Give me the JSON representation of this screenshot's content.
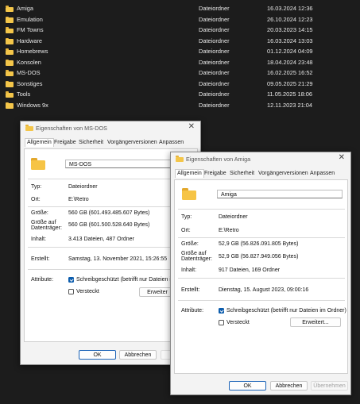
{
  "file_list": [
    {
      "name": "Amiga",
      "type": "Dateiordner",
      "date": "16.03.2024 12:36"
    },
    {
      "name": "Emulation",
      "type": "Dateiordner",
      "date": "26.10.2024 12:23"
    },
    {
      "name": "FM Towns",
      "type": "Dateiordner",
      "date": "20.03.2023 14:15"
    },
    {
      "name": "Hardware",
      "type": "Dateiordner",
      "date": "16.03.2024 13:03"
    },
    {
      "name": "Homebrews",
      "type": "Dateiordner",
      "date": "01.12.2024 04:09"
    },
    {
      "name": "Konsolen",
      "type": "Dateiordner",
      "date": "18.04.2024 23:48"
    },
    {
      "name": "MS-DOS",
      "type": "Dateiordner",
      "date": "16.02.2025 16:52"
    },
    {
      "name": "Sonstiges",
      "type": "Dateiordner",
      "date": "09.05.2025 21:29"
    },
    {
      "name": "Tools",
      "type": "Dateiordner",
      "date": "11.05.2025 18:06"
    },
    {
      "name": "Windows 9x",
      "type": "Dateiordner",
      "date": "12.11.2023 21:04"
    }
  ],
  "dlg1": {
    "title": "Eigenschaften von MS-DOS",
    "tabs": [
      "Allgemein",
      "Freigabe",
      "Sicherheit",
      "Vorgängerversionen",
      "Anpassen"
    ],
    "folder_name": "MS-DOS",
    "typ_label": "Typ:",
    "typ": "Dateiordner",
    "ort_label": "Ort:",
    "ort": "E:\\Retro",
    "groesse_label": "Größe:",
    "groesse": "560 GB (601.493.485.607 Bytes)",
    "groesse_dt_label1": "Größe auf",
    "groesse_dt_label2": "Datenträger:",
    "groesse_dt": "560 GB (601.500.528.640 Bytes)",
    "inhalt_label": "Inhalt:",
    "inhalt": "3.413 Dateien, 487 Ordner",
    "erstellt_label": "Erstellt:",
    "erstellt": "Samstag, 13. November 2021, 15:26:55",
    "attribute_label": "Attribute:",
    "readonly": "Schreibgeschützt (betrifft nur Dateien im",
    "hidden": "Versteckt",
    "advanced": "Erweiter",
    "ok": "OK",
    "cancel": "Abbrechen",
    "apply": "Üb"
  },
  "dlg2": {
    "title": "Eigenschaften von Amiga",
    "tabs": [
      "Allgemein",
      "Freigabe",
      "Sicherheit",
      "Vorgängerversionen",
      "Anpassen"
    ],
    "folder_name": "Amiga",
    "typ_label": "Typ:",
    "typ": "Dateiordner",
    "ort_label": "Ort:",
    "ort": "E:\\Retro",
    "groesse_label": "Größe:",
    "groesse": "52,9 GB (56.826.091.805 Bytes)",
    "groesse_dt_label1": "Größe auf",
    "groesse_dt_label2": "Datenträger:",
    "groesse_dt": "52,9 GB (56.827.949.056 Bytes)",
    "inhalt_label": "Inhalt:",
    "inhalt": "917 Dateien, 169 Ordner",
    "erstellt_label": "Erstellt:",
    "erstellt": "Dienstag, 15. August 2023, 09:00:16",
    "attribute_label": "Attribute:",
    "readonly": "Schreibgeschützt (betrifft nur Dateien im Ordner)",
    "hidden": "Versteckt",
    "advanced": "Erweitert...",
    "ok": "OK",
    "cancel": "Abbrechen",
    "apply": "Übernehmen"
  },
  "colors": {
    "accent": "#0b5cad",
    "folder": "#f6c445",
    "background": "#1c1c1c"
  },
  "icons": {
    "folder": "folder-icon",
    "close": "close-icon",
    "check": "check-icon"
  }
}
